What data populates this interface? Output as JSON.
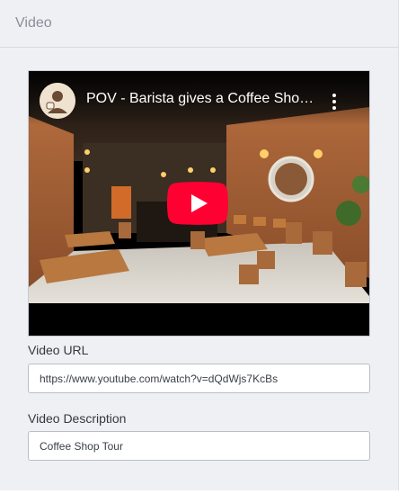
{
  "panel": {
    "title": "Video"
  },
  "video": {
    "title": "POV - Barista gives a Coffee Shop Tour",
    "icons": {
      "avatar": "channel-avatar",
      "more": "more-vertical-icon",
      "play": "youtube-play-icon"
    },
    "colors": {
      "play_button": "#ff0033",
      "frame_background": "#000000"
    }
  },
  "fields": {
    "video_url": {
      "label": "Video URL",
      "value": "https://www.youtube.com/watch?v=dQdWjs7KcBs"
    },
    "video_description": {
      "label": "Video Description",
      "value": "Coffee Shop Tour"
    }
  }
}
